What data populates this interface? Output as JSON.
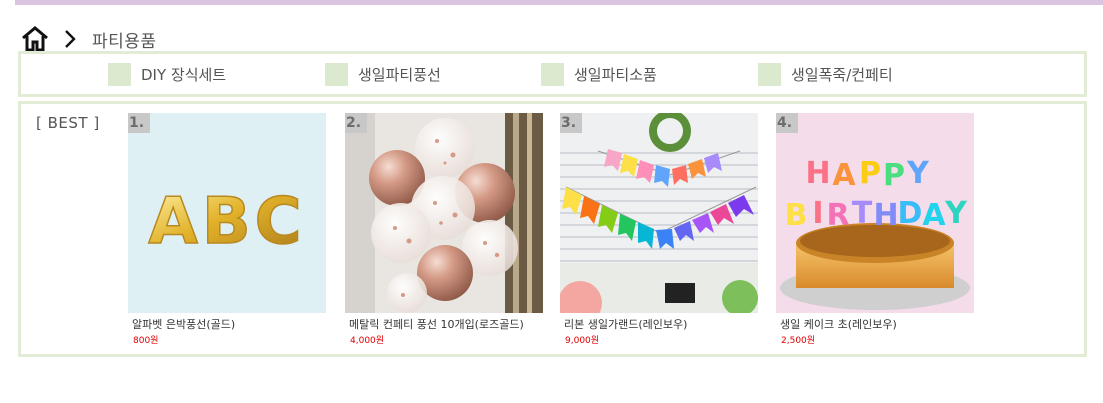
{
  "breadcrumb": {
    "home_icon": "home-icon",
    "separator_icon": "chevron-right-icon",
    "current": "파티용품"
  },
  "categories": [
    {
      "label": "DIY 장식세트",
      "icon": "square-swatch",
      "color": "#dbe9ce"
    },
    {
      "label": "생일파티풍선",
      "icon": "square-swatch",
      "color": "#dbe9ce"
    },
    {
      "label": "생일파티소품",
      "icon": "square-swatch",
      "color": "#dbe9ce"
    },
    {
      "label": "생일폭죽/컨페티",
      "icon": "square-swatch",
      "color": "#dbe9ce"
    }
  ],
  "best": {
    "title": "[ BEST ]",
    "products": [
      {
        "rank": "1.",
        "name": "알파벳 은박풍선(골드)",
        "price": "800원"
      },
      {
        "rank": "2.",
        "name": "메탈릭 컨페티 풍선 10개입(로즈골드)",
        "price": "4,000원"
      },
      {
        "rank": "3.",
        "name": "리본 생일가랜드(레인보우)",
        "price": "9,000원"
      },
      {
        "rank": "4.",
        "name": "생일 케이크 초(레인보우)",
        "price": "2,500원"
      }
    ]
  },
  "colors": {
    "top_bar": "#dbc3e2",
    "border": "#e1ebd6",
    "swatch": "#dbe9ce",
    "price": "#e00000"
  }
}
